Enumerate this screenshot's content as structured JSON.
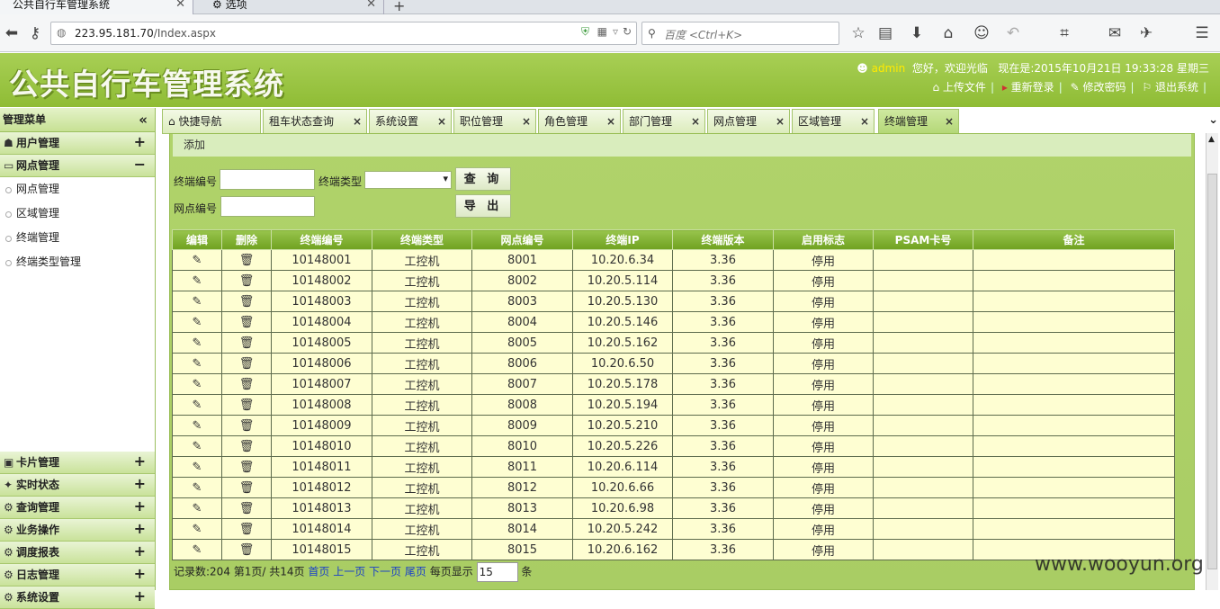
{
  "browser": {
    "tabs": [
      {
        "label": "公共自行车管理系统"
      },
      {
        "label": "选项"
      }
    ],
    "url_host": "223.95.181.70",
    "url_path": "/Index.aspx",
    "search_placeholder": "百度 <Ctrl+K>"
  },
  "header": {
    "title": "公共自行车管理系统",
    "user": "admin",
    "greeting": "您好，欢迎光临",
    "datetime": "现在是:2015年10月21日 19:33:28 星期三",
    "links": [
      "上传文件",
      "重新登录",
      "修改密码",
      "退出系统"
    ]
  },
  "sidebar": {
    "title": "管理菜单",
    "groups_top": [
      {
        "label": "用户管理",
        "sign": "+",
        "icon": "users-icon"
      },
      {
        "label": "网点管理",
        "sign": "−",
        "icon": "monitor-icon"
      }
    ],
    "items": [
      "网点管理",
      "区域管理",
      "终端管理",
      "终端类型管理"
    ],
    "groups_bottom": [
      {
        "label": "卡片管理",
        "sign": "+"
      },
      {
        "label": "实时状态",
        "sign": "+"
      },
      {
        "label": "查询管理",
        "sign": "+"
      },
      {
        "label": "业务操作",
        "sign": "+"
      },
      {
        "label": "调度报表",
        "sign": "+"
      },
      {
        "label": "日志管理",
        "sign": "+"
      },
      {
        "label": "系统设置",
        "sign": "+"
      }
    ]
  },
  "worktabs": [
    "快捷导航",
    "租车状态查询",
    "系统设置",
    "职位管理",
    "角色管理",
    "部门管理",
    "网点管理",
    "区域管理",
    "终端管理"
  ],
  "toolbar": {
    "add_label": "添加"
  },
  "form": {
    "terminal_no_label": "终端编号",
    "terminal_type_label": "终端类型",
    "site_no_label": "网点编号",
    "query_label": "查 询",
    "export_label": "导 出"
  },
  "table": {
    "columns": [
      "编辑",
      "删除",
      "终端编号",
      "终端类型",
      "网点编号",
      "终端IP",
      "终端版本",
      "启用标志",
      "PSAM卡号",
      "备注"
    ],
    "rows": [
      [
        "10148001",
        "工控机",
        "8001",
        "10.20.6.34",
        "3.36",
        "停用"
      ],
      [
        "10148002",
        "工控机",
        "8002",
        "10.20.5.114",
        "3.36",
        "停用"
      ],
      [
        "10148003",
        "工控机",
        "8003",
        "10.20.5.130",
        "3.36",
        "停用"
      ],
      [
        "10148004",
        "工控机",
        "8004",
        "10.20.5.146",
        "3.36",
        "停用"
      ],
      [
        "10148005",
        "工控机",
        "8005",
        "10.20.5.162",
        "3.36",
        "停用"
      ],
      [
        "10148006",
        "工控机",
        "8006",
        "10.20.6.50",
        "3.36",
        "停用"
      ],
      [
        "10148007",
        "工控机",
        "8007",
        "10.20.5.178",
        "3.36",
        "停用"
      ],
      [
        "10148008",
        "工控机",
        "8008",
        "10.20.5.194",
        "3.36",
        "停用"
      ],
      [
        "10148009",
        "工控机",
        "8009",
        "10.20.5.210",
        "3.36",
        "停用"
      ],
      [
        "10148010",
        "工控机",
        "8010",
        "10.20.5.226",
        "3.36",
        "停用"
      ],
      [
        "10148011",
        "工控机",
        "8011",
        "10.20.6.114",
        "3.36",
        "停用"
      ],
      [
        "10148012",
        "工控机",
        "8012",
        "10.20.6.66",
        "3.36",
        "停用"
      ],
      [
        "10148013",
        "工控机",
        "8013",
        "10.20.6.98",
        "3.36",
        "停用"
      ],
      [
        "10148014",
        "工控机",
        "8014",
        "10.20.5.242",
        "3.36",
        "停用"
      ],
      [
        "10148015",
        "工控机",
        "8015",
        "10.20.6.162",
        "3.36",
        "停用"
      ]
    ]
  },
  "pager": {
    "records": "记录数:204 第1页/ 共14页",
    "first": "首页",
    "prev": "上一页",
    "next": "下一页",
    "last": "尾页",
    "per_page_label": "每页显示",
    "per_page_value": "15",
    "unit": "条"
  },
  "watermark": "www.wooyun.org"
}
